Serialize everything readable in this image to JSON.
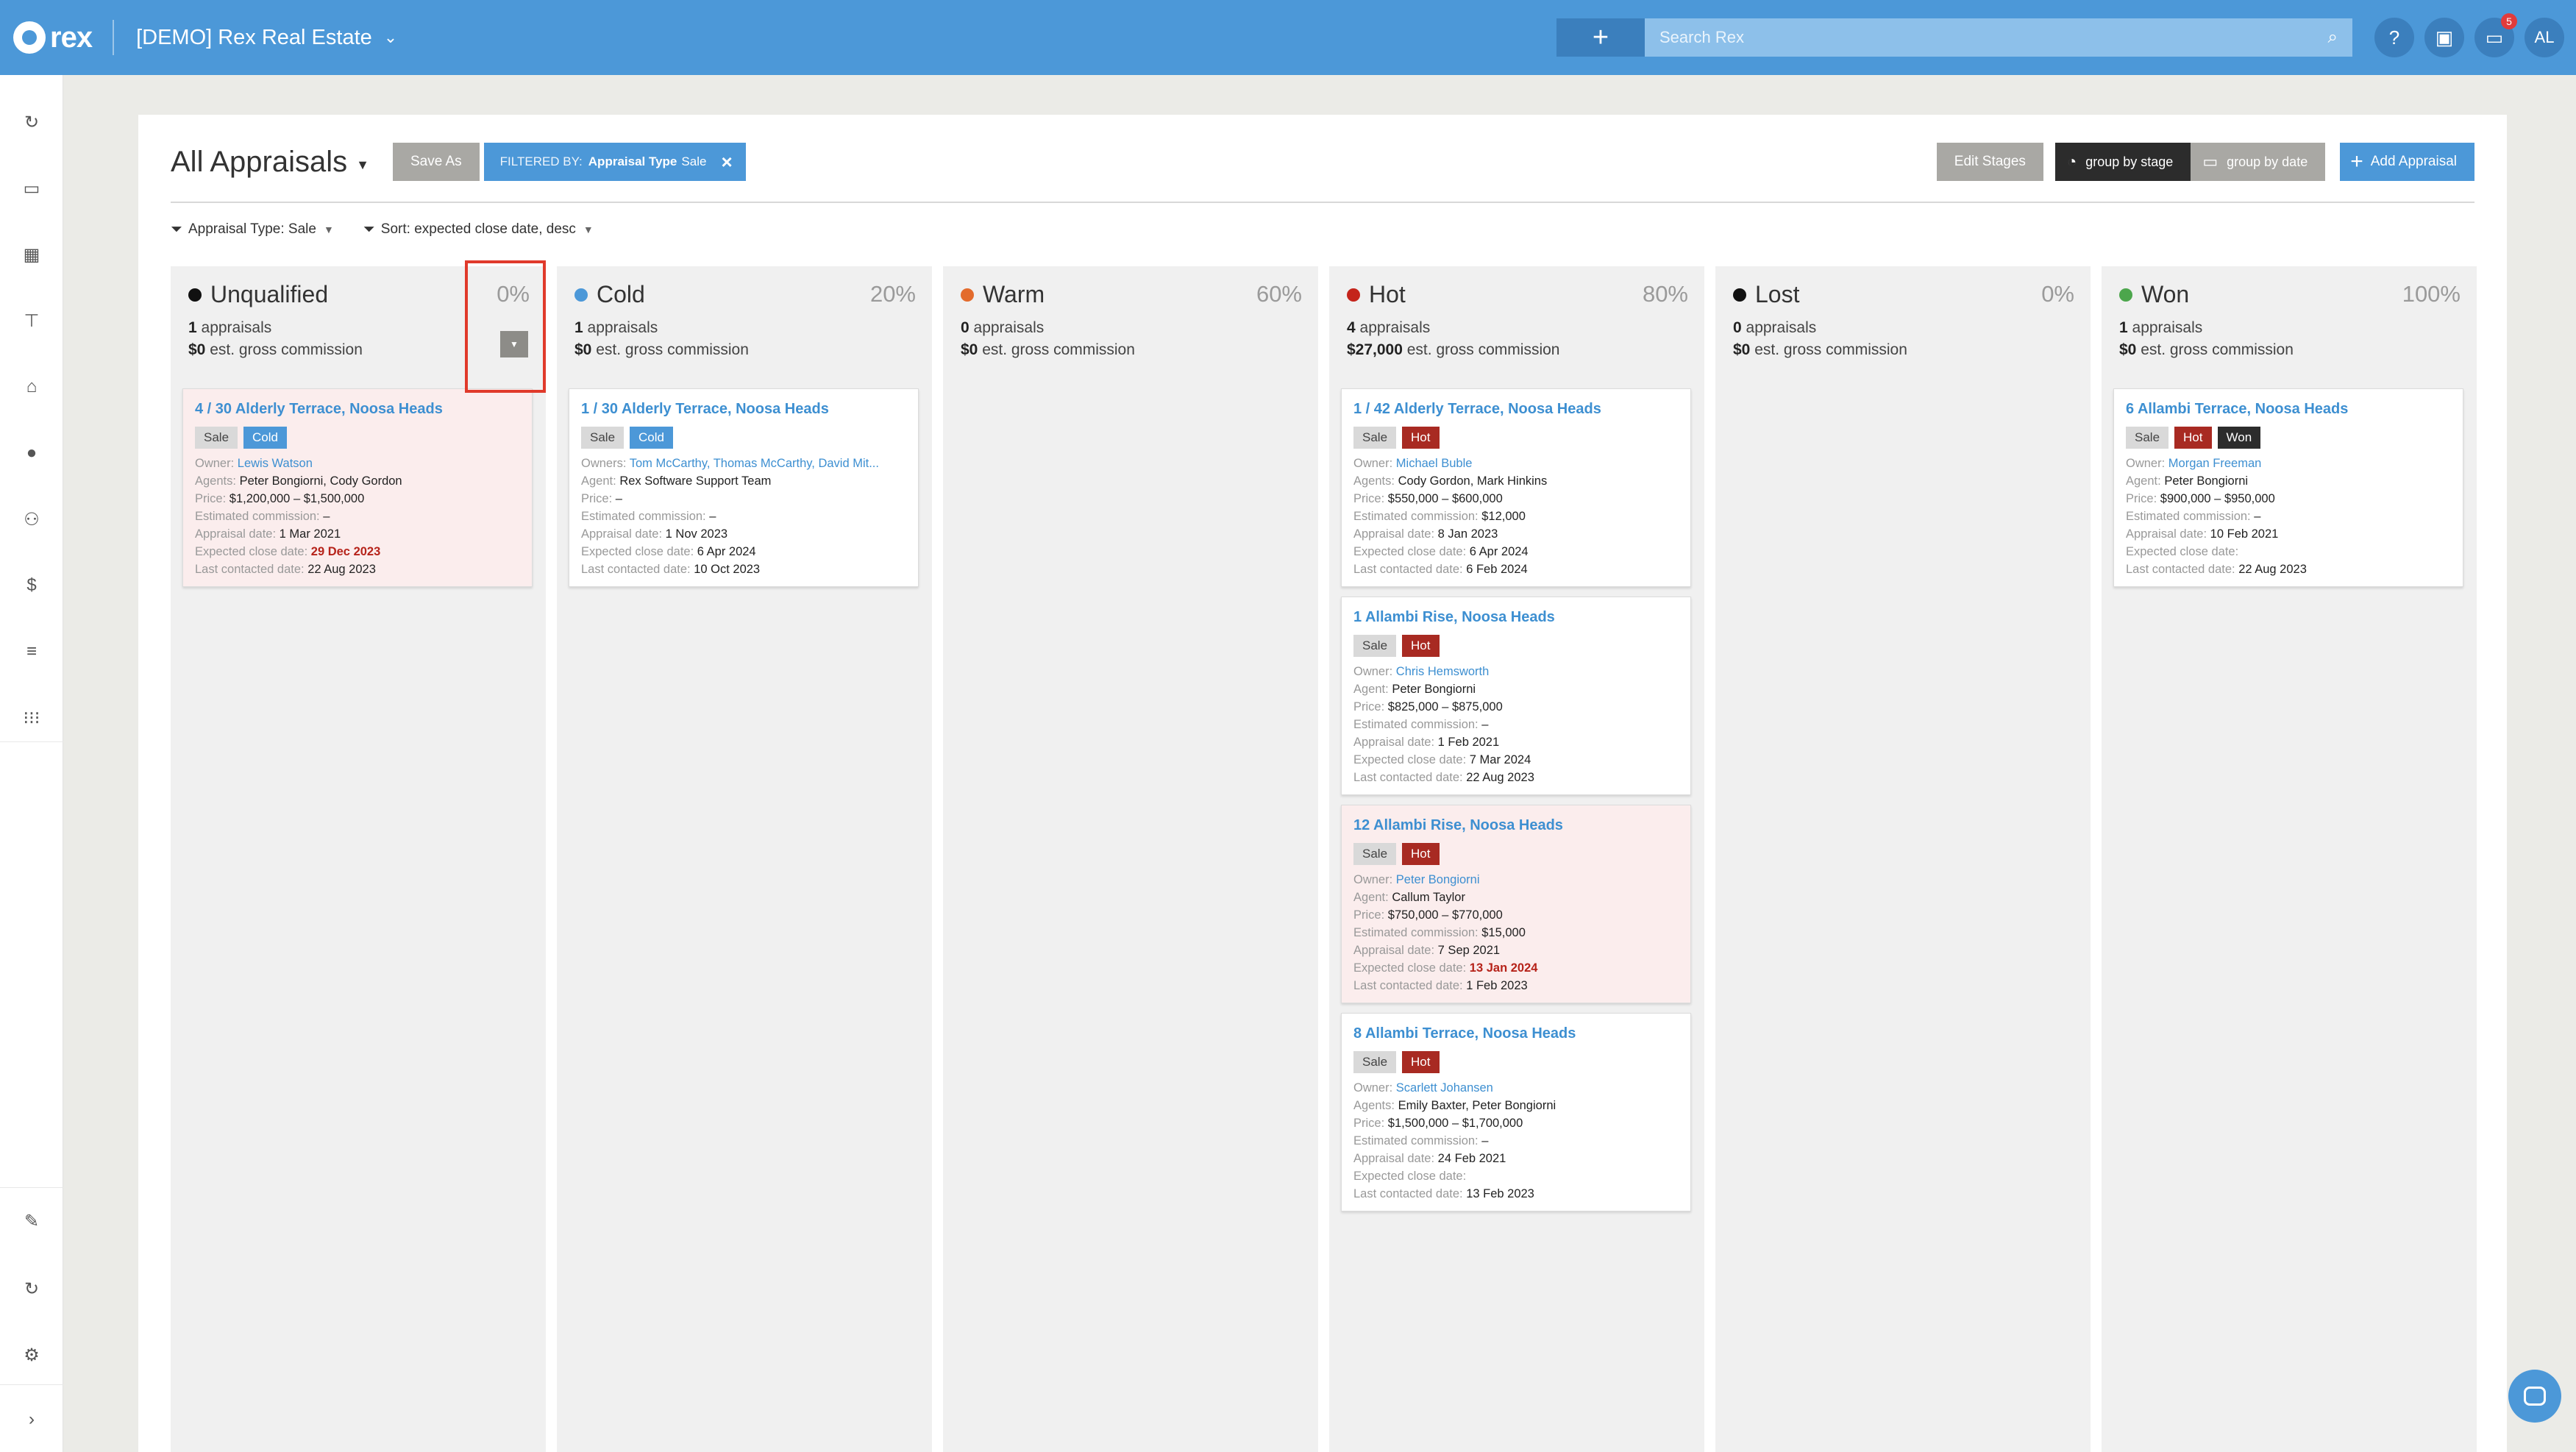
{
  "app": {
    "logo_text": "rex",
    "account": "[DEMO] Rex Real Estate",
    "search_placeholder": "Search Rex",
    "notifications_count": "5",
    "user_initials": "AL",
    "help_label": "?"
  },
  "page": {
    "title": "All Appraisals",
    "save_as": "Save As",
    "filter_chip_prefix": "FILTERED BY:",
    "filter_chip_field": "Appraisal Type",
    "filter_chip_value": "Sale",
    "edit_stages": "Edit Stages",
    "group_by_stage": "group by stage",
    "group_by_date": "group by date",
    "add_appraisal": "Add Appraisal",
    "filter_appraisal_type": "Appraisal Type: Sale",
    "sort_label": "Sort: expected close date, desc"
  },
  "columns": [
    {
      "name": "Unqualified",
      "percent": "0%",
      "dot_color": "#111111",
      "count": "1",
      "count_suffix": " appraisals",
      "commission": "$0",
      "commission_suffix": " est. gross commission",
      "cards": [
        {
          "title": "4 / 30 Alderly Terrace, Noosa Heads",
          "tags": [
            "Sale",
            "Cold"
          ],
          "overdue": true,
          "owner_label": "Owner:",
          "owner": "Lewis Watson",
          "agent_label": "Agents:",
          "agent": "Peter Bongiorni, Cody Gordon",
          "price": "$1,200,000 – $1,500,000",
          "commission": "–",
          "appraisal_date": "1 Mar 2021",
          "close_date": "29 Dec 2023",
          "last_contacted": "22 Aug 2023"
        }
      ]
    },
    {
      "name": "Cold",
      "percent": "20%",
      "dot_color": "#4c98d8",
      "count": "1",
      "count_suffix": " appraisals",
      "commission": "$0",
      "commission_suffix": " est. gross commission",
      "cards": [
        {
          "title": "1 / 30 Alderly Terrace, Noosa Heads",
          "tags": [
            "Sale",
            "Cold"
          ],
          "overdue": false,
          "owner_label": "Owners:",
          "owner": "Tom McCarthy, Thomas McCarthy, David Mit...",
          "agent_label": "Agent:",
          "agent": "Rex Software Support Team",
          "price": "–",
          "commission": "–",
          "appraisal_date": "1 Nov 2023",
          "close_date": "6 Apr 2024",
          "last_contacted": "10 Oct 2023"
        }
      ]
    },
    {
      "name": "Warm",
      "percent": "60%",
      "dot_color": "#e36b2c",
      "count": "0",
      "count_suffix": " appraisals",
      "commission": "$0",
      "commission_suffix": " est. gross commission",
      "cards": []
    },
    {
      "name": "Hot",
      "percent": "80%",
      "dot_color": "#c4241b",
      "count": "4",
      "count_suffix": " appraisals",
      "commission": "$27,000",
      "commission_suffix": " est. gross commission",
      "cards": [
        {
          "title": "1 / 42 Alderly Terrace, Noosa Heads",
          "tags": [
            "Sale",
            "Hot"
          ],
          "overdue": false,
          "owner_label": "Owner:",
          "owner": "Michael Buble",
          "agent_label": "Agents:",
          "agent": "Cody Gordon, Mark Hinkins",
          "price": "$550,000 – $600,000",
          "commission": "$12,000",
          "appraisal_date": "8 Jan 2023",
          "close_date": "6 Apr 2024",
          "last_contacted": "6 Feb 2024"
        },
        {
          "title": "1 Allambi Rise, Noosa Heads",
          "tags": [
            "Sale",
            "Hot"
          ],
          "overdue": false,
          "owner_label": "Owner:",
          "owner": "Chris Hemsworth",
          "agent_label": "Agent:",
          "agent": "Peter Bongiorni",
          "price": "$825,000 – $875,000",
          "commission": "–",
          "appraisal_date": "1 Feb 2021",
          "close_date": "7 Mar 2024",
          "last_contacted": "22 Aug 2023"
        },
        {
          "title": "12 Allambi Rise, Noosa Heads",
          "tags": [
            "Sale",
            "Hot"
          ],
          "overdue": true,
          "owner_label": "Owner:",
          "owner": "Peter Bongiorni",
          "agent_label": "Agent:",
          "agent": "Callum Taylor",
          "price": "$750,000 – $770,000",
          "commission": "$15,000",
          "appraisal_date": "7 Sep 2021",
          "close_date": "13 Jan 2024",
          "last_contacted": "1 Feb 2023"
        },
        {
          "title": "8 Allambi Terrace, Noosa Heads",
          "tags": [
            "Sale",
            "Hot"
          ],
          "overdue": false,
          "owner_label": "Owner:",
          "owner": "Scarlett Johansen",
          "agent_label": "Agents:",
          "agent": "Emily Baxter, Peter Bongiorni",
          "price": "$1,500,000 – $1,700,000",
          "commission": "–",
          "appraisal_date": "24 Feb 2021",
          "close_date": "",
          "last_contacted": "13 Feb 2023"
        }
      ]
    },
    {
      "name": "Lost",
      "percent": "0%",
      "dot_color": "#111111",
      "count": "0",
      "count_suffix": " appraisals",
      "commission": "$0",
      "commission_suffix": " est. gross commission",
      "cards": []
    },
    {
      "name": "Won",
      "percent": "100%",
      "dot_color": "#4ca64c",
      "count": "1",
      "count_suffix": " appraisals",
      "commission": "$0",
      "commission_suffix": " est. gross commission",
      "cards": [
        {
          "title": "6 Allambi Terrace, Noosa Heads",
          "tags": [
            "Sale",
            "Hot",
            "Won"
          ],
          "overdue": false,
          "owner_label": "Owner:",
          "owner": "Morgan Freeman",
          "agent_label": "Agent:",
          "agent": "Peter Bongiorni",
          "price": "$900,000 – $950,000",
          "commission": "–",
          "appraisal_date": "10 Feb 2021",
          "close_date": "",
          "last_contacted": "22 Aug 2023"
        }
      ]
    }
  ],
  "card_labels": {
    "price": "Price:",
    "commission": "Estimated commission:",
    "appraisal_date": "Appraisal date:",
    "close_date": "Expected close date:",
    "last_contacted": "Last contacted date:"
  },
  "nav_icons": [
    "refresh-icon",
    "calendar-icon",
    "reports-icon",
    "listings-icon",
    "properties-icon",
    "contacts-icon",
    "agents-icon",
    "finance-icon",
    "lists-icon",
    "apps-icon",
    "notes-icon",
    "sync-icon",
    "settings-icon",
    "expand-icon"
  ]
}
